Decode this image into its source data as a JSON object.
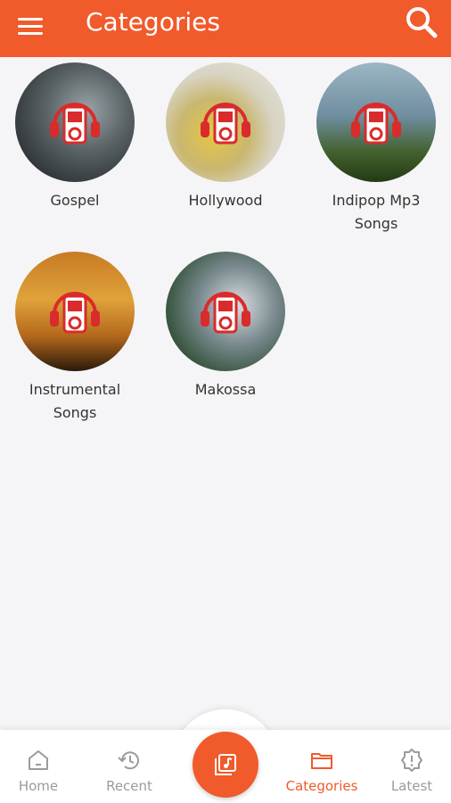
{
  "header": {
    "title": "Categories",
    "menu_icon": "hamburger-menu-icon",
    "search_icon": "search-icon"
  },
  "categories": [
    {
      "label": "Gospel",
      "icon": "music-player-headphones-icon"
    },
    {
      "label": "Hollywood",
      "icon": "music-player-headphones-icon"
    },
    {
      "label": "Indipop Mp3 Songs",
      "icon": "music-player-headphones-icon"
    },
    {
      "label": "Instrumental Songs",
      "icon": "music-player-headphones-icon"
    },
    {
      "label": "Makossa",
      "icon": "music-player-headphones-icon"
    }
  ],
  "bottom_nav": {
    "items": [
      {
        "label": "Home",
        "icon": "home-icon"
      },
      {
        "label": "Recent",
        "icon": "history-icon"
      },
      {
        "label": "Categories",
        "icon": "folder-icon"
      },
      {
        "label": "Latest",
        "icon": "alert-badge-icon"
      }
    ],
    "fab_icon": "music-library-icon",
    "active": "Categories"
  },
  "colors": {
    "accent": "#f15a2b",
    "background": "#f5f5f7",
    "inactive_nav": "#9b9b9b"
  }
}
